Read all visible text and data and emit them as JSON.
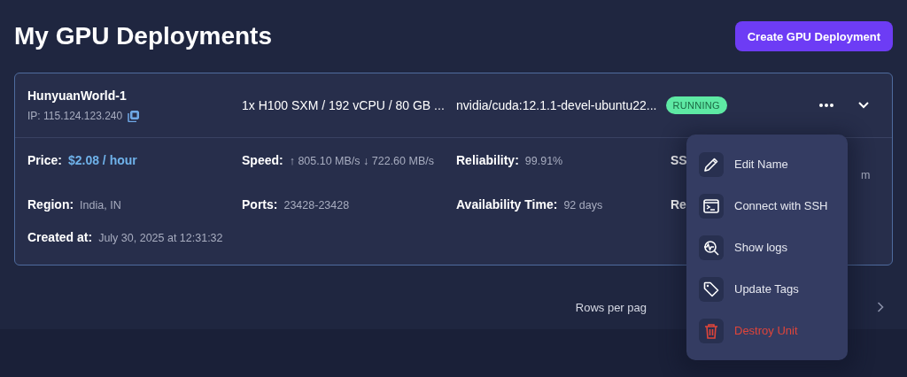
{
  "page": {
    "title": "My GPU Deployments",
    "create_button": "Create GPU Deployment"
  },
  "deployment": {
    "name": "HunyuanWorld-1",
    "ip": "IP: 115.124.123.240",
    "spec": "1x H100 SXM / 192 vCPU / 80 GB ...",
    "image": "nvidia/cuda:12.1.1-devel-ubuntu22...",
    "status": "RUNNING",
    "running": true,
    "details": [
      {
        "label": "Price:",
        "value": "$2.08 / hour",
        "kind": "price"
      },
      {
        "label": "Speed:",
        "value": "↑ 805.10 MB/s ↓ 722.60 MB/s",
        "kind": "plain"
      },
      {
        "label": "Reliability:",
        "value": "99.91%",
        "kind": "plain"
      },
      {
        "label": "SS",
        "kind": "cut"
      },
      {
        "label": "Region:",
        "value": "India, IN",
        "kind": "plain"
      },
      {
        "label": "Ports:",
        "value": "23428-23428",
        "kind": "plain"
      },
      {
        "label": "Availability Time:",
        "value": "92 days",
        "kind": "plain"
      },
      {
        "label": "Re",
        "kind": "cut"
      },
      {
        "label": "Created at:",
        "value": "July 30, 2025 at 12:31:32",
        "kind": "plain"
      }
    ],
    "hidden_value_tail": "m"
  },
  "menu": [
    {
      "label": "Edit Name",
      "kind": "edit"
    },
    {
      "label": "Connect with SSH",
      "kind": "terminal"
    },
    {
      "label": "Show logs",
      "kind": "logs"
    },
    {
      "label": "Update Tags",
      "kind": "tag"
    },
    {
      "label": "Destroy Unit",
      "kind": "destroy"
    }
  ],
  "pagination": {
    "rows_label": "Rows per pag"
  }
}
